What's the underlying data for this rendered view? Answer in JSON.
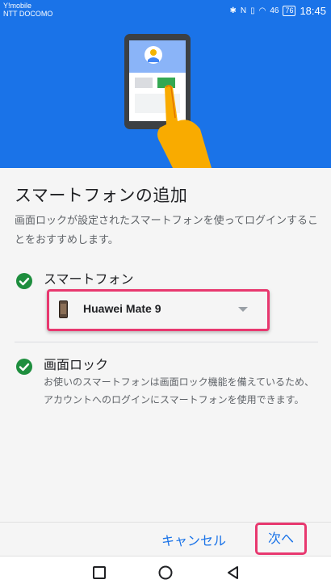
{
  "status_bar": {
    "carrier_line1": "Y!mobile",
    "carrier_line2": "NTT DOCOMO",
    "signal_text": "46",
    "battery": "76",
    "time": "18:45"
  },
  "page": {
    "title": "スマートフォンの追加",
    "description": "画面ロックが設定されたスマートフォンを使ってログインすることをおすすめします。"
  },
  "smartphone_section": {
    "label": "スマートフォン",
    "selected_device": "Huawei Mate 9"
  },
  "screen_lock_section": {
    "label": "画面ロック",
    "description": "お使いのスマートフォンは画面ロック機能を備えているため、アカウントへのログインにスマートフォンを使用できます。"
  },
  "footer": {
    "cancel_label": "キャンセル",
    "next_label": "次へ"
  },
  "colors": {
    "brand_blue": "#1a73e8",
    "check_green": "#1e8e3e",
    "highlight_pink": "#e8386f"
  },
  "icons": [
    "bluetooth-icon",
    "nfc-icon",
    "vibrate-icon",
    "wifi-icon",
    "signal-icon",
    "battery-icon",
    "check-icon",
    "dropdown-caret-icon",
    "square-nav-icon",
    "circle-nav-icon",
    "back-triangle-icon"
  ]
}
